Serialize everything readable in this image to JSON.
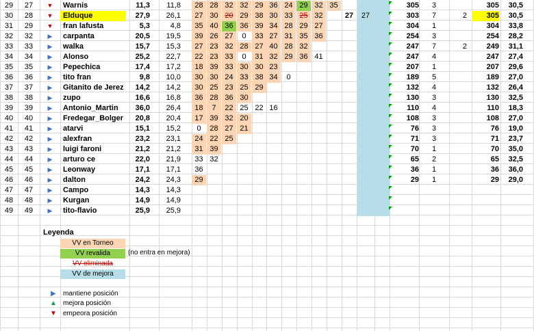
{
  "colors": {
    "tournament": "#fcd5b4",
    "revalidated": "#92d050",
    "eliminated": "#c00000",
    "improvement": "#b7dde8",
    "highlight": "#ffff00",
    "maintain": "#4472c4",
    "up": "#00a050",
    "down": "#c00000"
  },
  "rows": [
    {
      "rn": "29",
      "pos": "27",
      "ind": "down",
      "name": "Warnis",
      "v1": "11,3",
      "v2": "11,8",
      "scores": [
        {
          "v": "28",
          "t": "t"
        },
        {
          "v": "28",
          "t": "t"
        },
        {
          "v": "32",
          "t": "t"
        },
        {
          "v": "32",
          "t": "t"
        },
        {
          "v": "29",
          "t": "t"
        },
        {
          "v": "36",
          "t": "t"
        },
        {
          "v": "24",
          "t": "t"
        },
        {
          "v": "29",
          "t": "g"
        },
        {
          "v": "32",
          "t": "t"
        },
        {
          "v": "35",
          "t": "t"
        }
      ],
      "b1": "",
      "b2": "",
      "g1": "305",
      "g2": "3",
      "g3": "",
      "g4": "305",
      "g5": "30,5",
      "hl": false
    },
    {
      "rn": "30",
      "pos": "28",
      "ind": "down",
      "name": "Elduque",
      "v1": "27,9",
      "v2": "26,1",
      "scores": [
        {
          "v": "27",
          "t": "t"
        },
        {
          "v": "30",
          "t": "t"
        },
        {
          "v": "20",
          "t": "x"
        },
        {
          "v": "29",
          "t": "t"
        },
        {
          "v": "38",
          "t": "t"
        },
        {
          "v": "30",
          "t": "t"
        },
        {
          "v": "33",
          "t": "t"
        },
        {
          "v": "25",
          "t": "x"
        },
        {
          "v": "32",
          "t": "t"
        },
        {
          "v": "",
          "t": ""
        }
      ],
      "b1": "27",
      "b2": "27",
      "g1": "303",
      "g2": "7",
      "g3": "2",
      "g4": "305",
      "g5": "30,5",
      "hl": true
    },
    {
      "rn": "31",
      "pos": "29",
      "ind": "down",
      "name": "fran lafusta",
      "v1": "5,3",
      "v2": "4,8",
      "scores": [
        {
          "v": "35",
          "t": "t"
        },
        {
          "v": "40",
          "t": "t"
        },
        {
          "v": "36",
          "t": "g"
        },
        {
          "v": "36",
          "t": "t"
        },
        {
          "v": "39",
          "t": "t"
        },
        {
          "v": "34",
          "t": "t"
        },
        {
          "v": "28",
          "t": "t"
        },
        {
          "v": "29",
          "t": "t"
        },
        {
          "v": "27",
          "t": "t"
        },
        {
          "v": "",
          "t": ""
        }
      ],
      "b1": "",
      "b2": "",
      "g1": "304",
      "g2": "1",
      "g3": "",
      "g4": "304",
      "g5": "33,8",
      "hl": false
    },
    {
      "rn": "32",
      "pos": "32",
      "ind": "keep",
      "name": "carpanta",
      "v1": "20,5",
      "v2": "19,5",
      "scores": [
        {
          "v": "39",
          "t": "t"
        },
        {
          "v": "26",
          "t": "t"
        },
        {
          "v": "27",
          "t": "t"
        },
        {
          "v": "0",
          "t": ""
        },
        {
          "v": "33",
          "t": "t"
        },
        {
          "v": "27",
          "t": "t"
        },
        {
          "v": "31",
          "t": "t"
        },
        {
          "v": "35",
          "t": "t"
        },
        {
          "v": "36",
          "t": "t"
        },
        {
          "v": "",
          "t": ""
        }
      ],
      "b1": "",
      "b2": "",
      "g1": "254",
      "g2": "3",
      "g3": "",
      "g4": "254",
      "g5": "28,2",
      "hl": false
    },
    {
      "rn": "33",
      "pos": "33",
      "ind": "keep",
      "name": "walka",
      "v1": "15,7",
      "v2": "15,3",
      "scores": [
        {
          "v": "27",
          "t": "t"
        },
        {
          "v": "23",
          "t": "t"
        },
        {
          "v": "32",
          "t": "t"
        },
        {
          "v": "28",
          "t": "t"
        },
        {
          "v": "27",
          "t": "t"
        },
        {
          "v": "40",
          "t": "t"
        },
        {
          "v": "28",
          "t": "t"
        },
        {
          "v": "32",
          "t": "t"
        },
        {
          "v": "",
          "t": ""
        },
        {
          "v": "",
          "t": ""
        }
      ],
      "b1": "",
      "b2": "",
      "g1": "247",
      "g2": "7",
      "g3": "2",
      "g4": "249",
      "g5": "31,1",
      "hl": false
    },
    {
      "rn": "34",
      "pos": "34",
      "ind": "keep",
      "name": "Alonso",
      "v1": "25,2",
      "v2": "22,7",
      "scores": [
        {
          "v": "22",
          "t": "t"
        },
        {
          "v": "23",
          "t": "t"
        },
        {
          "v": "33",
          "t": "t"
        },
        {
          "v": "0",
          "t": ""
        },
        {
          "v": "31",
          "t": "t"
        },
        {
          "v": "32",
          "t": "t"
        },
        {
          "v": "29",
          "t": "t"
        },
        {
          "v": "36",
          "t": "t"
        },
        {
          "v": "41",
          "t": ""
        },
        {
          "v": "",
          "t": ""
        }
      ],
      "b1": "",
      "b2": "",
      "g1": "247",
      "g2": "4",
      "g3": "",
      "g4": "247",
      "g5": "27,4",
      "hl": false
    },
    {
      "rn": "35",
      "pos": "35",
      "ind": "keep",
      "name": "Pepechica",
      "v1": "17,4",
      "v2": "17,2",
      "scores": [
        {
          "v": "18",
          "t": "t"
        },
        {
          "v": "39",
          "t": "t"
        },
        {
          "v": "33",
          "t": "t"
        },
        {
          "v": "30",
          "t": "t"
        },
        {
          "v": "30",
          "t": "t"
        },
        {
          "v": "23",
          "t": "t"
        },
        {
          "v": "",
          "t": ""
        },
        {
          "v": "",
          "t": ""
        },
        {
          "v": "",
          "t": ""
        },
        {
          "v": "",
          "t": ""
        }
      ],
      "b1": "",
      "b2": "",
      "g1": "207",
      "g2": "1",
      "g3": "",
      "g4": "207",
      "g5": "29,6",
      "hl": false
    },
    {
      "rn": "36",
      "pos": "36",
      "ind": "keep",
      "name": "tito fran",
      "v1": "9,8",
      "v2": "10,0",
      "scores": [
        {
          "v": "30",
          "t": "t"
        },
        {
          "v": "30",
          "t": "t"
        },
        {
          "v": "24",
          "t": "t"
        },
        {
          "v": "33",
          "t": "t"
        },
        {
          "v": "38",
          "t": "t"
        },
        {
          "v": "34",
          "t": "t"
        },
        {
          "v": "0",
          "t": ""
        },
        {
          "v": "",
          "t": ""
        },
        {
          "v": "",
          "t": ""
        },
        {
          "v": "",
          "t": ""
        }
      ],
      "b1": "",
      "b2": "",
      "g1": "189",
      "g2": "5",
      "g3": "",
      "g4": "189",
      "g5": "27,0",
      "hl": false
    },
    {
      "rn": "37",
      "pos": "37",
      "ind": "keep",
      "name": "Gitanito de Jerez",
      "v1": "14,2",
      "v2": "14,2",
      "scores": [
        {
          "v": "30",
          "t": "t"
        },
        {
          "v": "25",
          "t": "t"
        },
        {
          "v": "23",
          "t": "t"
        },
        {
          "v": "25",
          "t": "t"
        },
        {
          "v": "29",
          "t": "t"
        },
        {
          "v": "",
          "t": ""
        },
        {
          "v": "",
          "t": ""
        },
        {
          "v": "",
          "t": ""
        },
        {
          "v": "",
          "t": ""
        },
        {
          "v": "",
          "t": ""
        }
      ],
      "b1": "",
      "b2": "",
      "g1": "132",
      "g2": "4",
      "g3": "",
      "g4": "132",
      "g5": "26,4",
      "hl": false
    },
    {
      "rn": "38",
      "pos": "38",
      "ind": "keep",
      "name": "zupo",
      "v1": "16,6",
      "v2": "16,8",
      "scores": [
        {
          "v": "36",
          "t": "t"
        },
        {
          "v": "28",
          "t": "t"
        },
        {
          "v": "36",
          "t": "t"
        },
        {
          "v": "30",
          "t": "t"
        },
        {
          "v": "",
          "t": ""
        },
        {
          "v": "",
          "t": ""
        },
        {
          "v": "",
          "t": ""
        },
        {
          "v": "",
          "t": ""
        },
        {
          "v": "",
          "t": ""
        },
        {
          "v": "",
          "t": ""
        }
      ],
      "b1": "",
      "b2": "",
      "g1": "130",
      "g2": "3",
      "g3": "",
      "g4": "130",
      "g5": "32,5",
      "hl": false
    },
    {
      "rn": "39",
      "pos": "39",
      "ind": "keep",
      "name": "Antonio_Martin",
      "v1": "36,0",
      "v2": "26,4",
      "scores": [
        {
          "v": "18",
          "t": "t"
        },
        {
          "v": "7",
          "t": "t"
        },
        {
          "v": "22",
          "t": "t"
        },
        {
          "v": "25",
          "t": ""
        },
        {
          "v": "22",
          "t": ""
        },
        {
          "v": "16",
          "t": ""
        },
        {
          "v": "",
          "t": ""
        },
        {
          "v": "",
          "t": ""
        },
        {
          "v": "",
          "t": ""
        },
        {
          "v": "",
          "t": ""
        }
      ],
      "b1": "",
      "b2": "",
      "g1": "110",
      "g2": "4",
      "g3": "",
      "g4": "110",
      "g5": "18,3",
      "hl": false
    },
    {
      "rn": "40",
      "pos": "40",
      "ind": "keep",
      "name": "Fredegar_Bolger",
      "v1": "20,8",
      "v2": "20,4",
      "scores": [
        {
          "v": "17",
          "t": "t"
        },
        {
          "v": "39",
          "t": "t"
        },
        {
          "v": "32",
          "t": "t"
        },
        {
          "v": "20",
          "t": "t"
        },
        {
          "v": "",
          "t": ""
        },
        {
          "v": "",
          "t": ""
        },
        {
          "v": "",
          "t": ""
        },
        {
          "v": "",
          "t": ""
        },
        {
          "v": "",
          "t": ""
        },
        {
          "v": "",
          "t": ""
        }
      ],
      "b1": "",
      "b2": "",
      "g1": "108",
      "g2": "3",
      "g3": "",
      "g4": "108",
      "g5": "27,0",
      "hl": false
    },
    {
      "rn": "41",
      "pos": "41",
      "ind": "keep",
      "name": "atarvi",
      "v1": "15,1",
      "v2": "15,2",
      "scores": [
        {
          "v": "0",
          "t": ""
        },
        {
          "v": "28",
          "t": "t"
        },
        {
          "v": "27",
          "t": "t"
        },
        {
          "v": "21",
          "t": "t"
        },
        {
          "v": "",
          "t": ""
        },
        {
          "v": "",
          "t": ""
        },
        {
          "v": "",
          "t": ""
        },
        {
          "v": "",
          "t": ""
        },
        {
          "v": "",
          "t": ""
        },
        {
          "v": "",
          "t": ""
        }
      ],
      "b1": "",
      "b2": "",
      "g1": "76",
      "g2": "3",
      "g3": "",
      "g4": "76",
      "g5": "19,0",
      "hl": false
    },
    {
      "rn": "42",
      "pos": "42",
      "ind": "keep",
      "name": "alexfran",
      "v1": "23,2",
      "v2": "23,1",
      "scores": [
        {
          "v": "24",
          "t": "t"
        },
        {
          "v": "22",
          "t": "t"
        },
        {
          "v": "25",
          "t": "t"
        },
        {
          "v": "",
          "t": ""
        },
        {
          "v": "",
          "t": ""
        },
        {
          "v": "",
          "t": ""
        },
        {
          "v": "",
          "t": ""
        },
        {
          "v": "",
          "t": ""
        },
        {
          "v": "",
          "t": ""
        },
        {
          "v": "",
          "t": ""
        }
      ],
      "b1": "",
      "b2": "",
      "g1": "71",
      "g2": "3",
      "g3": "",
      "g4": "71",
      "g5": "23,7",
      "hl": false
    },
    {
      "rn": "43",
      "pos": "43",
      "ind": "keep",
      "name": "luigi faroni",
      "v1": "21,2",
      "v2": "21,2",
      "scores": [
        {
          "v": "31",
          "t": "t"
        },
        {
          "v": "39",
          "t": "t"
        },
        {
          "v": "",
          "t": ""
        },
        {
          "v": "",
          "t": ""
        },
        {
          "v": "",
          "t": ""
        },
        {
          "v": "",
          "t": ""
        },
        {
          "v": "",
          "t": ""
        },
        {
          "v": "",
          "t": ""
        },
        {
          "v": "",
          "t": ""
        },
        {
          "v": "",
          "t": ""
        }
      ],
      "b1": "",
      "b2": "",
      "g1": "70",
      "g2": "1",
      "g3": "",
      "g4": "70",
      "g5": "35,0",
      "hl": false
    },
    {
      "rn": "44",
      "pos": "44",
      "ind": "keep",
      "name": "arturo ce",
      "v1": "22,0",
      "v2": "21,9",
      "scores": [
        {
          "v": "33",
          "t": ""
        },
        {
          "v": "32",
          "t": ""
        },
        {
          "v": "",
          "t": ""
        },
        {
          "v": "",
          "t": ""
        },
        {
          "v": "",
          "t": ""
        },
        {
          "v": "",
          "t": ""
        },
        {
          "v": "",
          "t": ""
        },
        {
          "v": "",
          "t": ""
        },
        {
          "v": "",
          "t": ""
        },
        {
          "v": "",
          "t": ""
        }
      ],
      "b1": "",
      "b2": "",
      "g1": "65",
      "g2": "2",
      "g3": "",
      "g4": "65",
      "g5": "32,5",
      "hl": false
    },
    {
      "rn": "45",
      "pos": "45",
      "ind": "keep",
      "name": "Leonway",
      "v1": "17,1",
      "v2": "17,1",
      "scores": [
        {
          "v": "36",
          "t": ""
        },
        {
          "v": "",
          "t": ""
        },
        {
          "v": "",
          "t": ""
        },
        {
          "v": "",
          "t": ""
        },
        {
          "v": "",
          "t": ""
        },
        {
          "v": "",
          "t": ""
        },
        {
          "v": "",
          "t": ""
        },
        {
          "v": "",
          "t": ""
        },
        {
          "v": "",
          "t": ""
        },
        {
          "v": "",
          "t": ""
        }
      ],
      "b1": "",
      "b2": "",
      "g1": "36",
      "g2": "1",
      "g3": "",
      "g4": "36",
      "g5": "36,0",
      "hl": false
    },
    {
      "rn": "46",
      "pos": "46",
      "ind": "keep",
      "name": "dalton",
      "v1": "24,2",
      "v2": "24,3",
      "scores": [
        {
          "v": "29",
          "t": "t"
        },
        {
          "v": "",
          "t": ""
        },
        {
          "v": "",
          "t": ""
        },
        {
          "v": "",
          "t": ""
        },
        {
          "v": "",
          "t": ""
        },
        {
          "v": "",
          "t": ""
        },
        {
          "v": "",
          "t": ""
        },
        {
          "v": "",
          "t": ""
        },
        {
          "v": "",
          "t": ""
        },
        {
          "v": "",
          "t": ""
        }
      ],
      "b1": "",
      "b2": "",
      "g1": "29",
      "g2": "1",
      "g3": "",
      "g4": "29",
      "g5": "29,0",
      "hl": false
    },
    {
      "rn": "47",
      "pos": "47",
      "ind": "keep",
      "name": "Campo",
      "v1": "14,3",
      "v2": "14,3",
      "scores": [],
      "b1": "",
      "b2": "",
      "g1": "",
      "g2": "",
      "g3": "",
      "g4": "",
      "g5": "",
      "hl": false
    },
    {
      "rn": "48",
      "pos": "48",
      "ind": "keep",
      "name": "Kurgan",
      "v1": "14,9",
      "v2": "14,9",
      "scores": [],
      "b1": "",
      "b2": "",
      "g1": "",
      "g2": "",
      "g3": "",
      "g4": "",
      "g5": "",
      "hl": false
    },
    {
      "rn": "49",
      "pos": "49",
      "ind": "keep",
      "name": "tito-flavio",
      "v1": "25,9",
      "v2": "25,9",
      "scores": [],
      "b1": "",
      "b2": "",
      "g1": "",
      "g2": "",
      "g3": "",
      "g4": "",
      "g5": "",
      "hl": false
    }
  ],
  "legend": {
    "title": "Leyenda",
    "tournament": "VV en Torneo",
    "revalidated": "VV revalida",
    "not_in_improvement": "(no entra en mejora)",
    "eliminated": "VV eliminada",
    "improvement": "VV de mejora",
    "maintain": "mantiene posición",
    "up": "mejora posición",
    "down": "empeora posición"
  }
}
